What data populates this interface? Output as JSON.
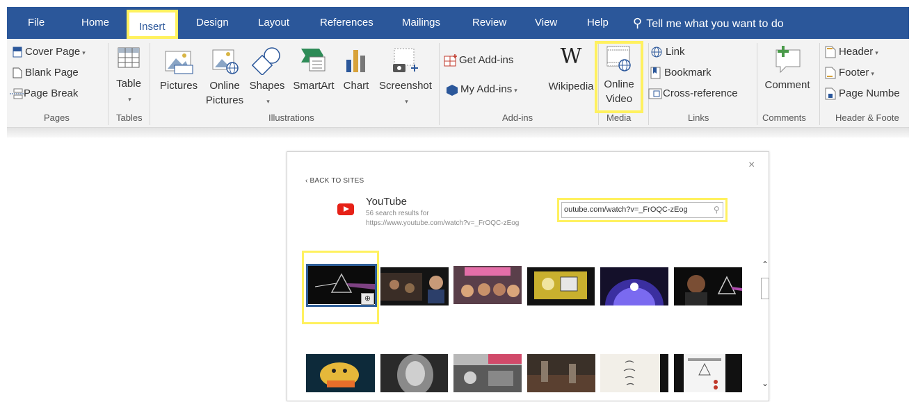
{
  "tabs": [
    {
      "label": "File",
      "active": false
    },
    {
      "label": "Home",
      "active": false
    },
    {
      "label": "Insert",
      "active": true
    },
    {
      "label": "Design",
      "active": false
    },
    {
      "label": "Layout",
      "active": false
    },
    {
      "label": "References",
      "active": false
    },
    {
      "label": "Mailings",
      "active": false
    },
    {
      "label": "Review",
      "active": false
    },
    {
      "label": "View",
      "active": false
    },
    {
      "label": "Help",
      "active": false
    }
  ],
  "tell_me": "Tell me what you want to do",
  "ribbon": {
    "pages": {
      "cover_page": "Cover Page",
      "blank_page": "Blank Page",
      "page_break": "Page Break",
      "label": "Pages"
    },
    "tables": {
      "table": "Table",
      "label": "Tables"
    },
    "illustrations": {
      "pictures": "Pictures",
      "online_pictures_1": "Online",
      "online_pictures_2": "Pictures",
      "shapes": "Shapes",
      "smartart": "SmartArt",
      "chart": "Chart",
      "screenshot": "Screenshot",
      "label": "Illustrations"
    },
    "addins": {
      "get_addins": "Get Add-ins",
      "my_addins": "My Add-ins",
      "wikipedia": "Wikipedia",
      "label": "Add-ins"
    },
    "media": {
      "online_video_1": "Online",
      "online_video_2": "Video",
      "label": "Media"
    },
    "links": {
      "link": "Link",
      "bookmark": "Bookmark",
      "cross_reference": "Cross-reference",
      "label": "Links"
    },
    "comments": {
      "comment": "Comment",
      "label": "Comments"
    },
    "header_footer": {
      "header": "Header",
      "footer": "Footer",
      "page_number": "Page Numbe",
      "label": "Header & Foote"
    }
  },
  "dialog": {
    "back": "‹ BACK TO SITES",
    "close": "×",
    "site_name": "YouTube",
    "result_count": "56 search results for",
    "query": "https://www.youtube.com/watch?v=_FrOQC-zEog",
    "search_value": "outube.com/watch?v=_FrOQC-zEog",
    "zoom_glyph": "⊕"
  },
  "colors": {
    "tab_bar": "#2b579a",
    "highlight": "#fff15f",
    "youtube_red": "#e62117"
  }
}
